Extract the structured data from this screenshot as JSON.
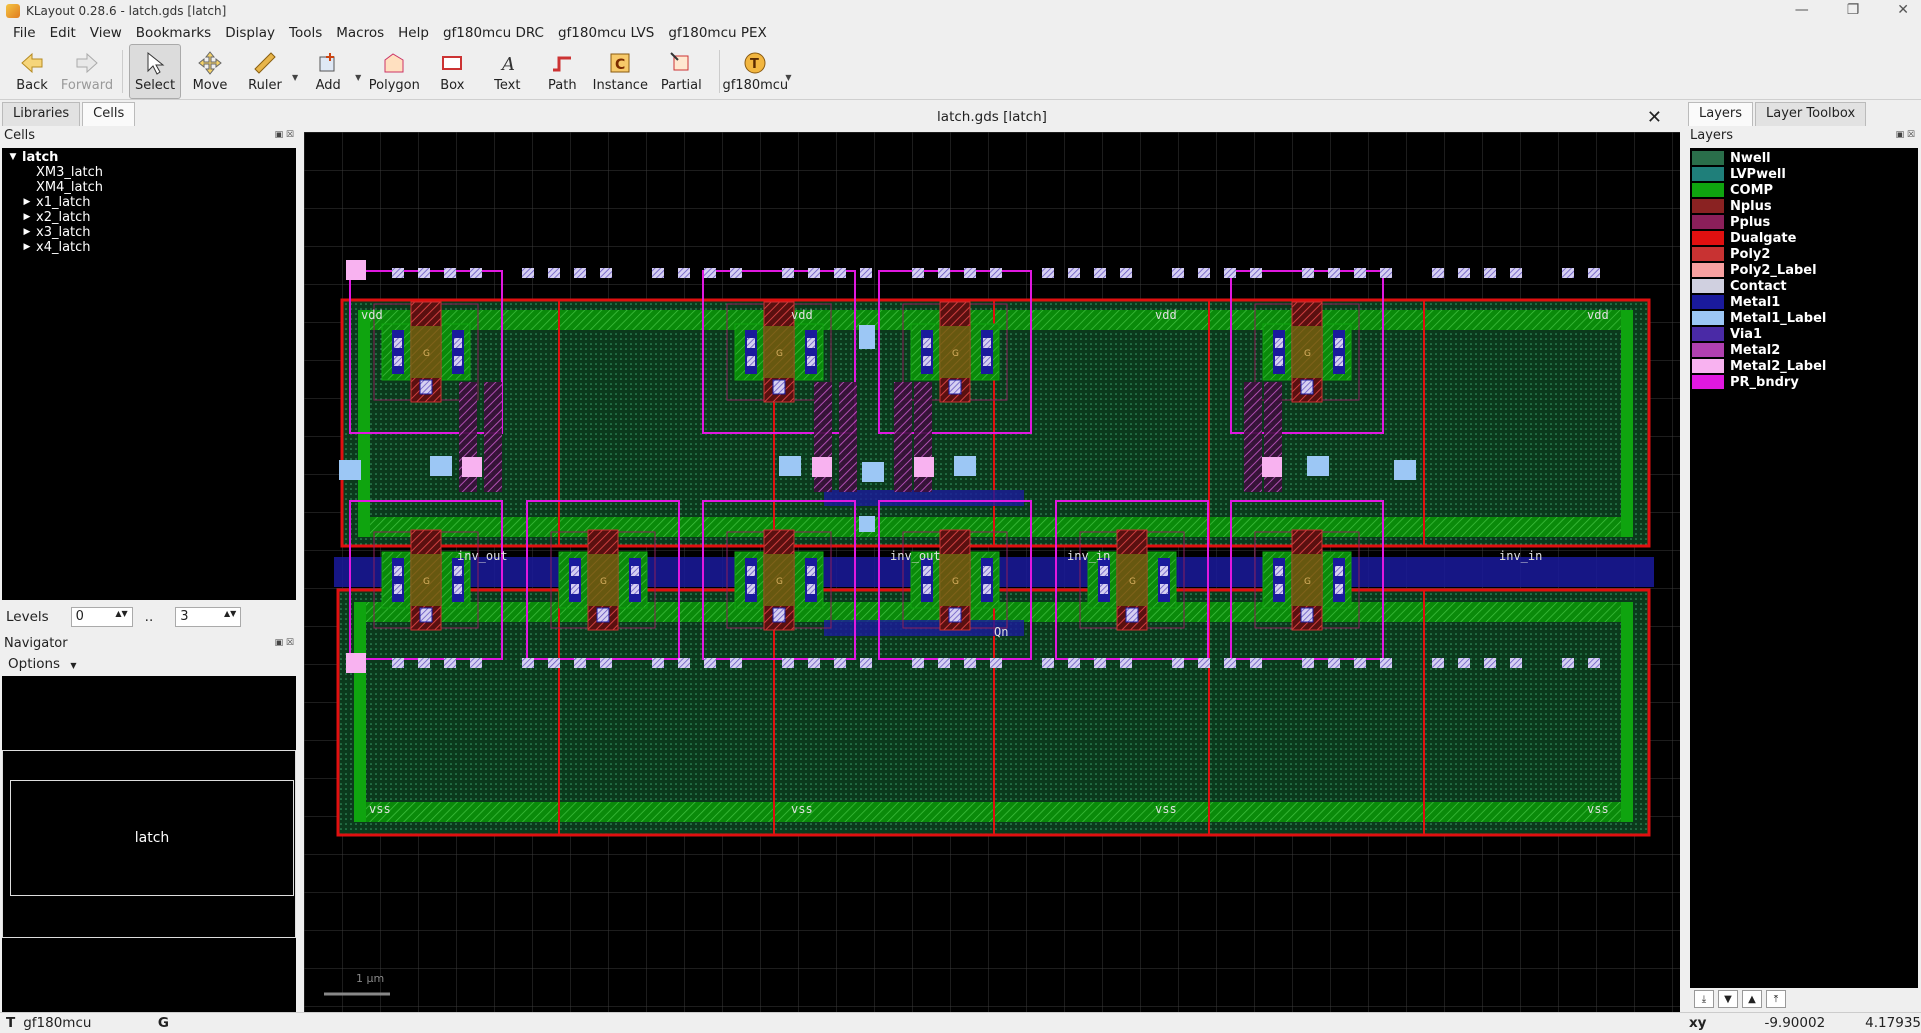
{
  "window": {
    "title": "KLayout 0.28.6 - latch.gds [latch]",
    "controls": [
      "—",
      "❐",
      "✕"
    ]
  },
  "menu": [
    "File",
    "Edit",
    "View",
    "Bookmarks",
    "Display",
    "Tools",
    "Macros",
    "Help",
    "gf180mcu DRC",
    "gf180mcu LVS",
    "gf180mcu PEX"
  ],
  "toolbar": {
    "back": "Back",
    "forward": "Forward",
    "select": "Select",
    "move": "Move",
    "ruler": "Ruler",
    "add": "Add",
    "polygon": "Polygon",
    "box": "Box",
    "text": "Text",
    "path": "Path",
    "instance": "Instance",
    "partial": "Partial",
    "tech": "gf180mcu"
  },
  "left": {
    "tabs": [
      "Libraries",
      "Cells"
    ],
    "cells_title": "Cells",
    "tree": [
      {
        "label": "latch",
        "arrow": "▼",
        "indent": 0,
        "root": true
      },
      {
        "label": "XM3_latch",
        "arrow": "",
        "indent": 1
      },
      {
        "label": "XM4_latch",
        "arrow": "",
        "indent": 1
      },
      {
        "label": "x1_latch",
        "arrow": "▶",
        "indent": 1
      },
      {
        "label": "x2_latch",
        "arrow": "▶",
        "indent": 1
      },
      {
        "label": "x3_latch",
        "arrow": "▶",
        "indent": 1
      },
      {
        "label": "x4_latch",
        "arrow": "▶",
        "indent": 1
      }
    ],
    "levels_label": "Levels",
    "level_from": "0",
    "level_sep": "..",
    "level_to": "3",
    "navigator_title": "Navigator",
    "options_label": "Options",
    "navigator_cell": "latch"
  },
  "canvas": {
    "title": "latch.gds [latch]",
    "scale_label": "1 µm",
    "labels": [
      "vdd",
      "vdd",
      "vdd",
      "vdd",
      "vss",
      "vss",
      "vss",
      "vss",
      "inv_out",
      "inv_out",
      "inv_in",
      "inv_in",
      "Qn"
    ]
  },
  "right": {
    "tabs": [
      "Layers",
      "Layer Toolbox"
    ],
    "title": "Layers",
    "layers": [
      {
        "name": "Nwell",
        "color": "#2a6e4a"
      },
      {
        "name": "LVPwell",
        "color": "#1f7f7a"
      },
      {
        "name": "COMP",
        "color": "#0fa40f"
      },
      {
        "name": "Nplus",
        "color": "#8a2222"
      },
      {
        "name": "Pplus",
        "color": "#8b1f5a"
      },
      {
        "name": "Dualgate",
        "color": "#e01010"
      },
      {
        "name": "Poly2",
        "color": "#c83232"
      },
      {
        "name": "Poly2_Label",
        "color": "#f7a0a0"
      },
      {
        "name": "Contact",
        "color": "#d0d0e0"
      },
      {
        "name": "Metal1",
        "color": "#1a1a9c"
      },
      {
        "name": "Metal1_Label",
        "color": "#9cc7f5"
      },
      {
        "name": "Via1",
        "color": "#4a2aa6"
      },
      {
        "name": "Metal2",
        "color": "#b040b0"
      },
      {
        "name": "Metal2_Label",
        "color": "#f8b2f0"
      },
      {
        "name": "PR_bndry",
        "color": "#e018e0"
      }
    ]
  },
  "status": {
    "tech_icon": "T",
    "tech": "gf180mcu",
    "grid": "G",
    "coord_label": "xy",
    "x": "-9.90002",
    "y": "4.17935"
  }
}
